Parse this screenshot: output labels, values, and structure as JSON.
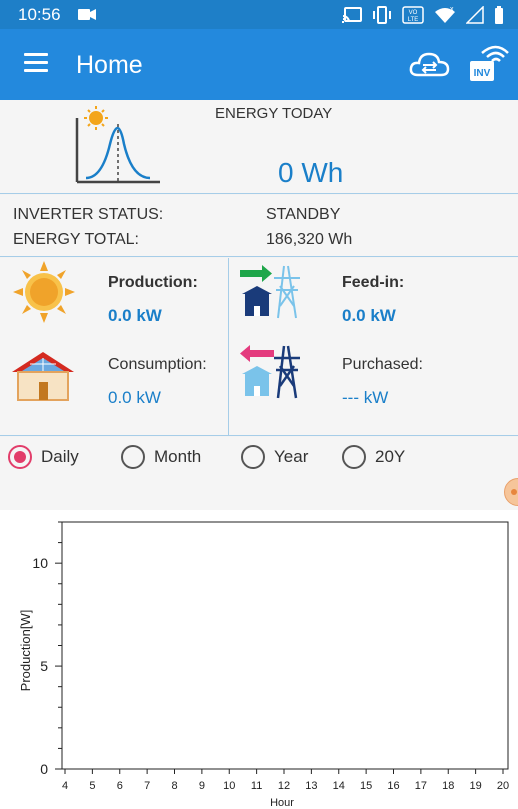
{
  "status_bar": {
    "time": "10:56",
    "icons": [
      "video-camera-icon",
      "cast-icon",
      "vibrate-icon",
      "volte-icon",
      "wifi-icon",
      "signal-icon",
      "battery-icon"
    ],
    "volte_label": "VO\nLTE"
  },
  "app_bar": {
    "title": "Home",
    "menu_icon": "hamburger-menu-icon",
    "cloud_icon": "cloud-sync-icon",
    "inverter_icon": "inverter-wifi-icon",
    "inverter_badge": "INV"
  },
  "energy_today": {
    "label": "ENERGY TODAY",
    "value": "0 Wh",
    "icon": "solar-curve-icon"
  },
  "inverter": {
    "status_label": "INVERTER STATUS:",
    "status_value": "STANDBY",
    "total_label": "ENERGY TOTAL:",
    "total_value": "186,320 Wh"
  },
  "power": {
    "production": {
      "label": "Production:",
      "value": "0.0 kW",
      "icon": "sun-icon"
    },
    "feed_in": {
      "label": "Feed-in:",
      "value": "0.0 kW",
      "icon": "feed-in-grid-icon"
    },
    "consumption": {
      "label": "Consumption:",
      "value": "0.0 kW",
      "icon": "house-icon"
    },
    "purchased": {
      "label": "Purchased:",
      "value": "--- kW",
      "icon": "purchase-grid-icon"
    }
  },
  "period_options": [
    {
      "label": "Daily",
      "selected": true
    },
    {
      "label": "Month",
      "selected": false
    },
    {
      "label": "Year",
      "selected": false
    },
    {
      "label": "20Y",
      "selected": false
    }
  ],
  "colors": {
    "primary": "#2389dd",
    "status_bar": "#1e7fc8",
    "value_blue": "#1a7fc9",
    "radio_selected": "#e23d6a"
  },
  "chart_data": {
    "type": "line",
    "xlabel": "Hour",
    "ylabel": "Production[W]",
    "x_ticks": [
      4,
      5,
      6,
      7,
      8,
      9,
      10,
      11,
      12,
      13,
      14,
      15,
      16,
      17,
      18,
      19,
      20
    ],
    "y_ticks": [
      0,
      5,
      10
    ],
    "xlim": [
      4,
      20
    ],
    "ylim": [
      0,
      12
    ],
    "series": []
  }
}
